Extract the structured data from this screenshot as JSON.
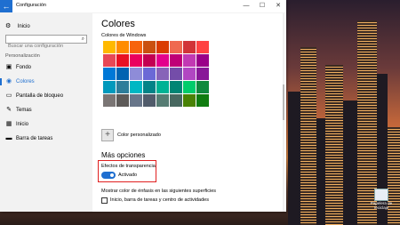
{
  "window": {
    "title": "Configuración",
    "back_glyph": "←",
    "minimize": "—",
    "maximize": "☐",
    "close": "✕"
  },
  "sidebar": {
    "home": {
      "icon": "gear-icon",
      "label": "Inicio",
      "glyph": "⚙"
    },
    "search": {
      "placeholder": "Buscar una configuración",
      "icon": "search-icon",
      "glyph": "⌕"
    },
    "section": "Personalización",
    "items": [
      {
        "label": "Fondo",
        "icon": "picture-icon",
        "glyph": "▣"
      },
      {
        "label": "Colores",
        "icon": "palette-icon",
        "glyph": "◉",
        "active": true
      },
      {
        "label": "Pantalla de bloqueo",
        "icon": "monitor-icon",
        "glyph": "▭"
      },
      {
        "label": "Temas",
        "icon": "brush-icon",
        "glyph": "✎"
      },
      {
        "label": "Inicio",
        "icon": "start-icon",
        "glyph": "▦"
      },
      {
        "label": "Barra de tareas",
        "icon": "taskbar-icon",
        "glyph": "▬"
      }
    ]
  },
  "main": {
    "title": "Colores",
    "colors_heading": "Colores de Windows",
    "swatches": [
      "#ffb900",
      "#ff8c00",
      "#f7630c",
      "#ca5010",
      "#da3b01",
      "#ef6950",
      "#d13438",
      "#ff4343",
      "#e74856",
      "#e81123",
      "#ea005e",
      "#c30052",
      "#e3008c",
      "#bf0077",
      "#c239b3",
      "#9a0089",
      "#0078d7",
      "#0063b1",
      "#8e8cd8",
      "#6b69d6",
      "#8764b8",
      "#744da9",
      "#b146c2",
      "#881798",
      "#0099bc",
      "#2d7d9a",
      "#00b7c3",
      "#038387",
      "#00b294",
      "#018574",
      "#00cc6a",
      "#10893e",
      "#7a7574",
      "#5d5a58",
      "#68768a",
      "#515c6b",
      "#567c73",
      "#486860",
      "#498205",
      "#107c10"
    ],
    "custom_color": {
      "label": "Color personalizado",
      "glyph": "+",
      "icon": "plus-icon"
    },
    "more_options": "Más opciones",
    "transparency": {
      "label": "Efectos de transparencia",
      "state": "Activado",
      "on": true
    },
    "emphasis_label": "Mostrar color de énfasis en las siguientes superficies",
    "checkbox": {
      "label": "Inicio, barra de tareas y centro de actividades",
      "checked": false
    }
  },
  "desktop": {
    "icon_label": "Papelera de reciclaje"
  }
}
